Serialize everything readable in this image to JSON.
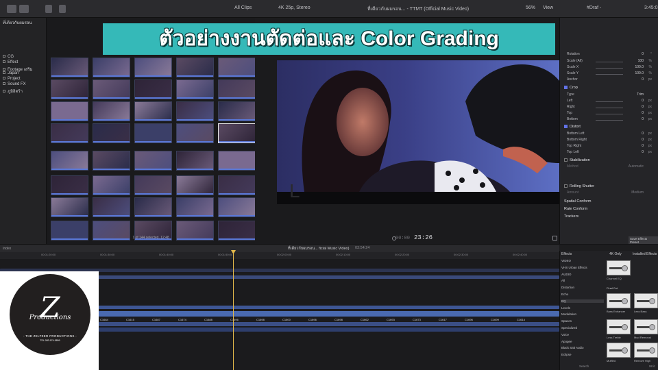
{
  "banner": {
    "title": "ตัวอย่างงานตัดต่อและ Color Grading"
  },
  "toolbar": {
    "clips_filter": "All Clips",
    "format_info": "4K 25p, Stereo",
    "project_title": "ที่เดียวกับผมรอน... - TTMT (Official Music Video)",
    "zoom": "56%",
    "view": "View",
    "inspector_title": "#Draf - ",
    "inspector_time": "3:45:0"
  },
  "sidebar": {
    "header": "ที่เดียวกับผมรอน",
    "items": [
      {
        "label": "CG"
      },
      {
        "label": "Effect"
      },
      {
        "label": "Footage เสริม"
      },
      {
        "label": "Japan"
      },
      {
        "label": "Project"
      },
      {
        "label": "Sound FX"
      },
      {
        "label": "ภูมิอิดร้า"
      }
    ]
  },
  "browser": {
    "status": "1 of 144 selected, 12:48"
  },
  "viewer": {
    "timecode": "23:26",
    "timecode_prefix": "00:00"
  },
  "inspector": {
    "rows": [
      {
        "label": "Rotation",
        "value": "0",
        "unit": "°"
      },
      {
        "label": "Scale (All)",
        "value": "100",
        "unit": "%"
      },
      {
        "label": "Scale X",
        "value": "100.0",
        "unit": "%"
      },
      {
        "label": "Scale Y",
        "value": "100.0",
        "unit": "%"
      },
      {
        "label": "Anchor",
        "value": "0",
        "unit": "px"
      }
    ],
    "crop": {
      "label": "Crop",
      "type_label": "Type",
      "type_value": "Trim",
      "rows": [
        {
          "label": "Left",
          "value": "0",
          "unit": "px"
        },
        {
          "label": "Right",
          "value": "0",
          "unit": "px"
        },
        {
          "label": "Top",
          "value": "0",
          "unit": "px"
        },
        {
          "label": "Bottom",
          "value": "0",
          "unit": "px"
        }
      ]
    },
    "distort": {
      "label": "Distort",
      "rows": [
        {
          "label": "Bottom Left",
          "value": "0",
          "unit": "px"
        },
        {
          "label": "Bottom Right",
          "value": "0",
          "unit": "px"
        },
        {
          "label": "Top Right",
          "value": "0",
          "unit": "px"
        },
        {
          "label": "Top Left",
          "value": "0",
          "unit": "px"
        }
      ]
    },
    "stabilization": {
      "label": "Stabilization",
      "method": "Automatic",
      "method_label": "Method"
    },
    "rolling": {
      "label": "Rolling Shutter",
      "amount": "Medium",
      "amount_label": "Amount"
    },
    "spatial": "Spatial Conform",
    "rate": "Rate Conform",
    "trackers": "Trackers",
    "save_preset": "Save Effects Preset"
  },
  "timeline": {
    "index": "Index",
    "title": "ที่เดียวกับผมรอน... ficial Music Video)",
    "duration": "03:54:24",
    "ruler": [
      "00:01:20:00",
      "00:01:30:00",
      "00:01:40:00",
      "00:01:50:00",
      "00:02:00:00",
      "00:02:10:00",
      "00:02:20:00",
      "00:02:30:00",
      "00:02:40:00"
    ],
    "clip_labels": [
      "C1684",
      "C1615",
      "C1687",
      "C1674",
      "C1688",
      "C1696",
      "C1698",
      "C1600",
      "C1696",
      "C1698",
      "C1662",
      "C1693",
      "C1673",
      "C1617",
      "C1696",
      "C1699",
      "C1614"
    ]
  },
  "effects": {
    "tab": "Effects",
    "filter": "4K Only",
    "installed": "Installed Effects",
    "categories": [
      {
        "label": "VIDEO",
        "header": true
      },
      {
        "label": "VHS Urban Effects"
      },
      {
        "label": "AUDIO",
        "header": true
      },
      {
        "label": "All"
      },
      {
        "label": "Distortion"
      },
      {
        "label": "Echo"
      },
      {
        "label": "EQ",
        "selected": true
      },
      {
        "label": "Levels"
      },
      {
        "label": "Modulation"
      },
      {
        "label": "Spaces"
      },
      {
        "label": "Specialized"
      },
      {
        "label": "Voice"
      },
      {
        "label": "Apogee"
      },
      {
        "label": "Black Salt Audio"
      },
      {
        "label": "Eclipse"
      }
    ],
    "group_label": "Final Cut",
    "items": [
      {
        "label": "Channel EQ"
      },
      {
        "label": "Bass Enhancer"
      },
      {
        "label": "Less Bass"
      },
      {
        "label": "Less Treble"
      },
      {
        "label": "Mud Removal"
      },
      {
        "label": "Muffled"
      },
      {
        "label": "Remove High"
      }
    ],
    "search_placeholder": "Search",
    "count": "98 it"
  },
  "logo": {
    "mark": "Z",
    "word": "Productions",
    "name": "- THE ZELTZER PRODUCTIONS -",
    "tel": "TEL.083-974-5899"
  },
  "colors": {
    "banner": "#35b9b8",
    "playhead": "#e3b84a",
    "accent": "#6272e6"
  }
}
